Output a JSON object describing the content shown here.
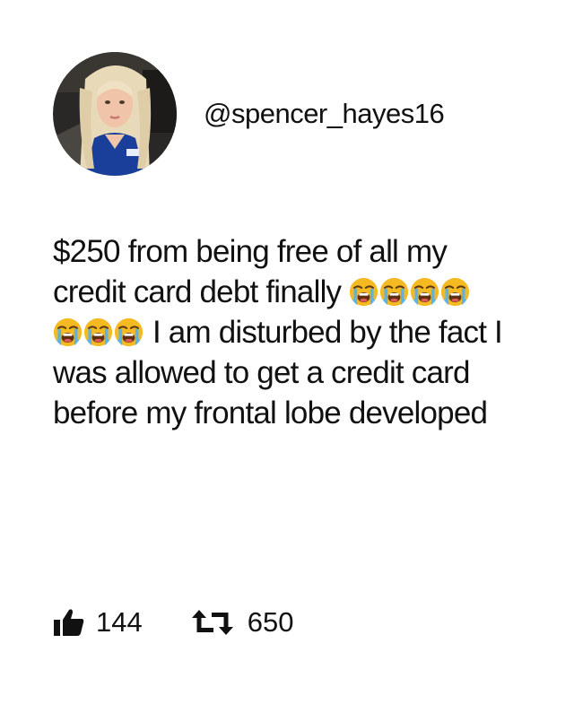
{
  "profile": {
    "handle": "@spencer_hayes16",
    "avatar_icon": "profile-photo"
  },
  "post": {
    "lines": [
      {
        "text": "$250 from being free of all my",
        "emoji_before": 0,
        "emoji_after": 0
      },
      {
        "text": "credit card debt finally",
        "emoji_before": 0,
        "emoji_after": 4
      },
      {
        "text": "I am disturbed by the fact I",
        "emoji_before": 3,
        "emoji_after": 0
      },
      {
        "text": "was allowed to get a credit card",
        "emoji_before": 0,
        "emoji_after": 0
      },
      {
        "text": "before my frontal lobe developed",
        "emoji_before": 0,
        "emoji_after": 0
      }
    ],
    "emoji": "loudly-crying-face"
  },
  "stats": {
    "likes": "144",
    "like_icon": "thumbs-up-icon",
    "retweets": "650",
    "retweet_icon": "retweet-icon"
  },
  "colors": {
    "text": "#111111",
    "background": "#ffffff",
    "emoji_face": "#f5b921",
    "emoji_tear": "#5ab4ea"
  }
}
